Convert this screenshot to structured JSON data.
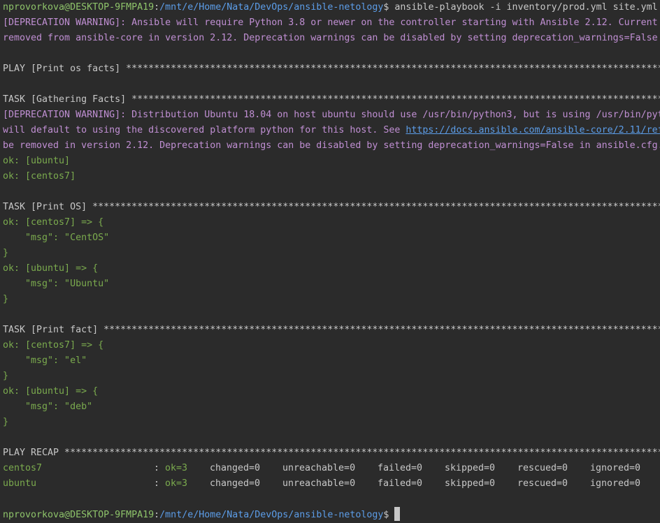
{
  "prompt": {
    "user": "nprovorkova@DESKTOP-9FMPA19",
    "sep": ":",
    "path": "/mnt/e/Home/Nata/DevOps/ansible-netology",
    "dollar": "$",
    "command": " ansible-playbook -i inventory/prod.yml site.yml"
  },
  "output": {
    "warn1_a": "[DEPRECATION WARNING]: Ansible will require Python 3.8 or newer on the controller starting with Ansible 2.12. Current",
    "warn1_b": "removed from ansible-core in version 2.12. Deprecation warnings can be disabled by setting deprecation_warnings=False",
    "play": "PLAY [Print os facts] ******************************************************************************************************",
    "task_gather": "TASK [Gathering Facts] *****************************************************************************************************",
    "warn2_a": "[DEPRECATION WARNING]: Distribution Ubuntu 18.04 on host ubuntu should use /usr/bin/python3, but is using /usr/bin/pyt",
    "warn2_b_pre": "will default to using the discovered platform python for this host. See ",
    "warn2_b_link": "https://docs.ansible.com/ansible-core/2.11/ref",
    "warn2_c": "be removed in version 2.12. Deprecation warnings can be disabled by setting deprecation_warnings=False in ansible.cfg.",
    "ok_ubuntu": "ok: [ubuntu]",
    "ok_centos7": "ok: [centos7]",
    "task_os": "TASK [Print OS] ************************************************************************************************************",
    "os_centos_open": "ok: [centos7] => {",
    "os_centos_msg": "    \"msg\": \"CentOS\"",
    "close1": "}",
    "os_ubuntu_open": "ok: [ubuntu] => {",
    "os_ubuntu_msg": "    \"msg\": \"Ubuntu\"",
    "close2": "}",
    "task_fact": "TASK [Print fact] **********************************************************************************************************",
    "fact_centos_open": "ok: [centos7] => {",
    "fact_centos_msg": "    \"msg\": \"el\"",
    "close3": "}",
    "fact_ubuntu_open": "ok: [ubuntu] => {",
    "fact_ubuntu_msg": "    \"msg\": \"deb\"",
    "close4": "}",
    "recap": "PLAY RECAP *****************************************************************************************************************"
  },
  "recap_rows": [
    {
      "host": "centos7",
      "colon": ":",
      "ok": "ok=3",
      "changed": "changed=0",
      "unreachable": "unreachable=0",
      "failed": "failed=0",
      "skipped": "skipped=0",
      "rescued": "rescued=0",
      "ignored": "ignored=0"
    },
    {
      "host": "ubuntu",
      "colon": ":",
      "ok": "ok=3",
      "changed": "changed=0",
      "unreachable": "unreachable=0",
      "failed": "failed=0",
      "skipped": "skipped=0",
      "rescued": "rescued=0",
      "ignored": "ignored=0"
    }
  ],
  "colors": {
    "background": "#2b2b2b",
    "ok_green": "#7bab4e",
    "warning_purple": "#c08fd3",
    "path_blue": "#5c9de8",
    "text": "#c8c8c8"
  }
}
